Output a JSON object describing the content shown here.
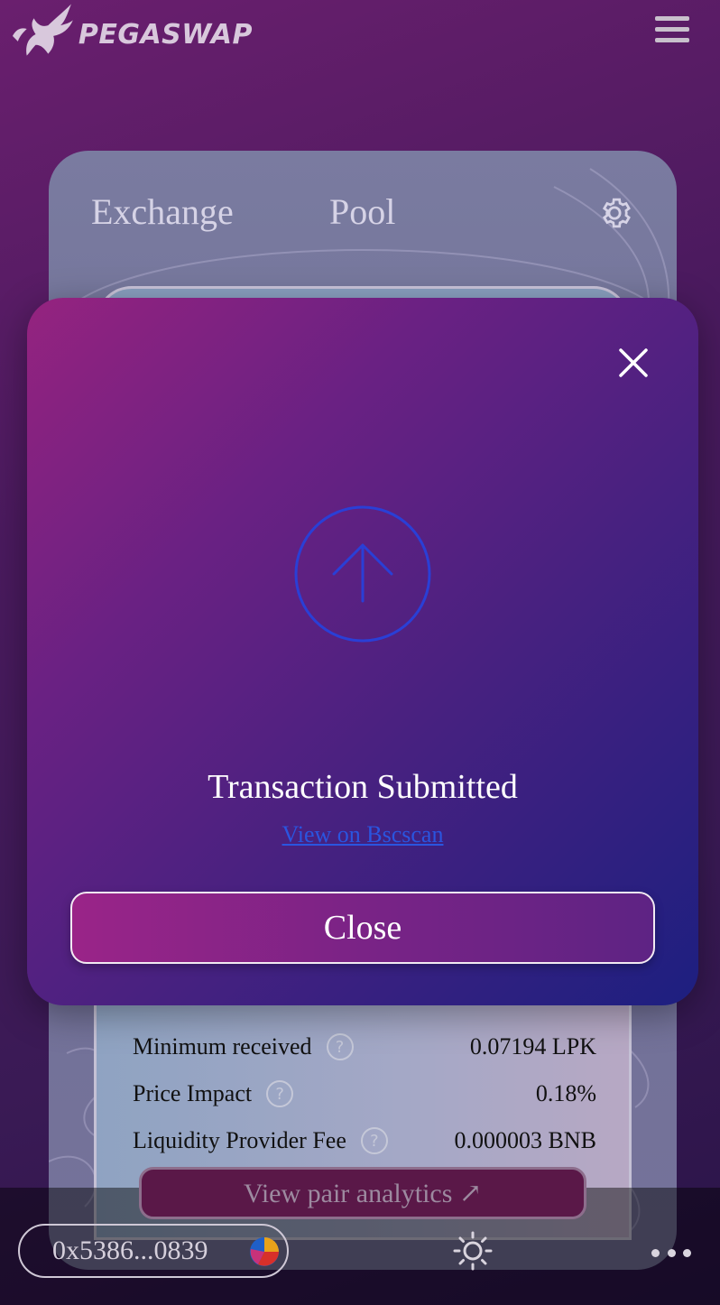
{
  "header": {
    "logo_text": "PEGASWAP",
    "logo_icon": "pegasus-icon",
    "menu_icon": "hamburger-icon"
  },
  "swap_card": {
    "tabs": [
      {
        "label": "Exchange"
      },
      {
        "label": "Pool"
      }
    ],
    "settings_icon": "gear-icon"
  },
  "modal": {
    "icon": "arrow-up-circle-icon",
    "icon_color": "#2a3fd6",
    "title": "Transaction Submitted",
    "link_text": "View on Bscscan",
    "close_button": "Close",
    "close_icon": "close-icon"
  },
  "details": {
    "rows": [
      {
        "label": "Minimum received",
        "value": "0.07194 LPK"
      },
      {
        "label": "Price Impact",
        "value": "0.18%"
      },
      {
        "label": "Liquidity Provider Fee",
        "value": "0.000003 BNB"
      }
    ],
    "help_glyph": "?",
    "analytics_button": "View pair analytics ↗"
  },
  "bottom_bar": {
    "wallet_address": "0x5386...0839",
    "theme_icon": "sun-icon",
    "more_icon": "more-dots-icon"
  }
}
